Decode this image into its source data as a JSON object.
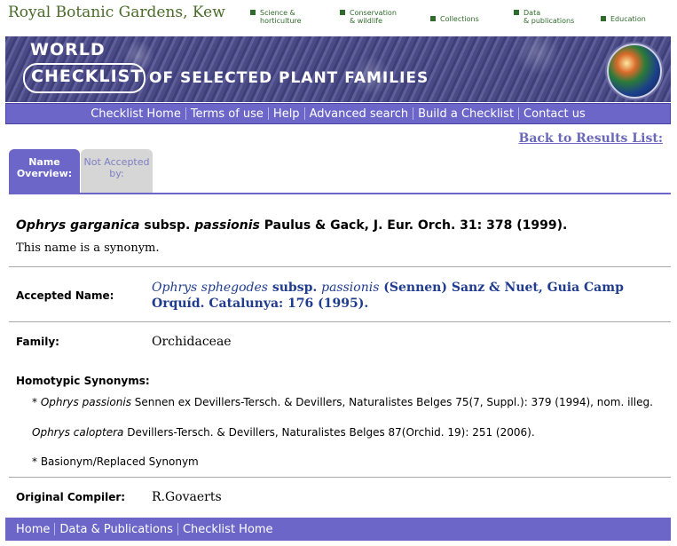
{
  "site": {
    "name": "Royal Botanic Gardens, Kew"
  },
  "topnav": [
    {
      "line1": "Science &",
      "line2": "horticulture"
    },
    {
      "line1": "Conservation",
      "line2": "& wildlife"
    },
    {
      "line1": "Collections",
      "line2": ""
    },
    {
      "line1": "Data",
      "line2": "& publications"
    },
    {
      "line1": "Education",
      "line2": ""
    }
  ],
  "banner": {
    "world": "WORLD",
    "checklist": "CHECKLIST",
    "rest": "OF SELECTED PLANT FAMILIES"
  },
  "menu": [
    "Checklist Home",
    "Terms of use",
    "Help",
    "Advanced search",
    "Build a Checklist",
    "Contact us"
  ],
  "back_link": "Back to Results List:",
  "tabs": {
    "name_overview": {
      "line1": "Name",
      "line2": "Overview:"
    },
    "not_accepted": {
      "line1": "Not Accepted",
      "line2": "by:"
    }
  },
  "name": {
    "genus_species": "Ophrys garganica",
    "rank": " subsp. ",
    "infra": "passionis",
    "authority": " Paulus & Gack, J. Eur. Orch. 31: 378 (1999)."
  },
  "status_text": "This name is a synonym.",
  "labels": {
    "accepted": "Accepted Name:",
    "family": "Family:",
    "homotypic": "Homotypic Synonyms:",
    "compiler": "Original Compiler:"
  },
  "accepted": {
    "genus_species": "Ophrys sphegodes",
    "rank": " subsp. ",
    "infra": "passionis",
    "authority": " (Sennen) Sanz & Nuet, Guia Camp Orquíd. Catalunya: 176 (1995)."
  },
  "family": "Orchidaceae",
  "synonyms": [
    {
      "prefix": "* ",
      "name": "Ophrys passionis",
      "ref": " Sennen ex Devillers-Tersch. & Devillers, Naturalistes Belges 75(7, Suppl.): 379 (1994), nom. illeg."
    },
    {
      "prefix": "",
      "name": "Ophrys caloptera",
      "ref": " Devillers-Tersch. & Devillers, Naturalistes Belges 87(Orchid. 19): 251 (2006)."
    }
  ],
  "basionym_note": "* Basionym/Replaced Synonym",
  "compiler": "R.Govaerts",
  "footer_links": [
    "Home",
    "Data & Publications",
    "Checklist Home"
  ],
  "colors": {
    "accent": "#6b66c7",
    "kew_green": "#4a6b2a",
    "link_blue": "#1f3c8f"
  }
}
